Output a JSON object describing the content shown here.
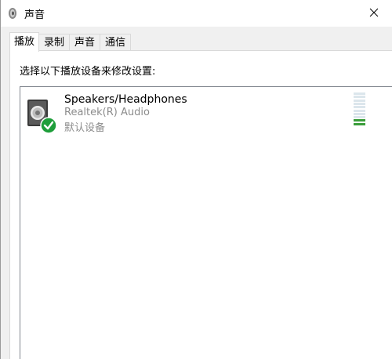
{
  "window": {
    "title": "声音",
    "tabs": [
      {
        "label": "播放",
        "active": true
      },
      {
        "label": "录制",
        "active": false
      },
      {
        "label": "声音",
        "active": false
      },
      {
        "label": "通信",
        "active": false
      }
    ]
  },
  "playback": {
    "instruction": "选择以下播放设备来修改设置:",
    "devices": [
      {
        "name": "Speakers/Headphones",
        "driver": "Realtek(R) Audio",
        "status": "默认设备",
        "icon": "speaker-icon",
        "badge": "default-check-icon",
        "level_segments_total": 10,
        "level_segments_lit": 2
      }
    ]
  },
  "colors": {
    "badge_green": "#1e9e3a",
    "level_lit": "#3a9d3a",
    "level_unlit": "#dce6ec",
    "secondary_text": "#8c8c8c"
  }
}
